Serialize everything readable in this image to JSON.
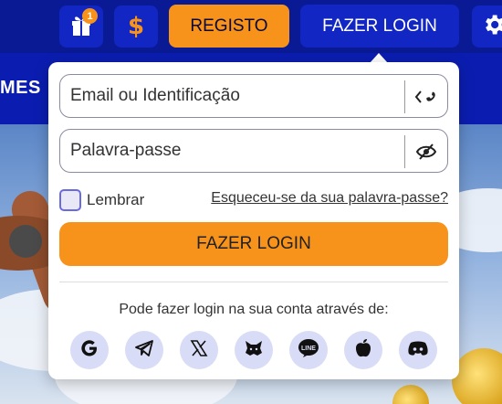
{
  "header": {
    "gift_badge": "1",
    "currency_symbol": "$",
    "register_label": "REGISTO",
    "login_label": "FAZER LOGIN"
  },
  "nav": {
    "partial_label": "MES"
  },
  "login_form": {
    "email_placeholder": "Email ou Identificação",
    "password_placeholder": "Palavra-passe",
    "remember_label": "Lembrar",
    "remember_checked": false,
    "forgot_link": "Esqueceu-se da sua palavra-passe?",
    "submit_label": "FAZER LOGIN",
    "social_title": "Pode fazer login na sua conta através de:",
    "social_providers": [
      "google-icon",
      "telegram-icon",
      "x-icon",
      "metamask-icon",
      "line-icon",
      "apple-icon",
      "discord-icon"
    ]
  },
  "colors": {
    "header_bg": "#0a1a94",
    "button_blue": "#1226c4",
    "accent_orange": "#f7931a",
    "social_bg": "#d9dcf6"
  }
}
